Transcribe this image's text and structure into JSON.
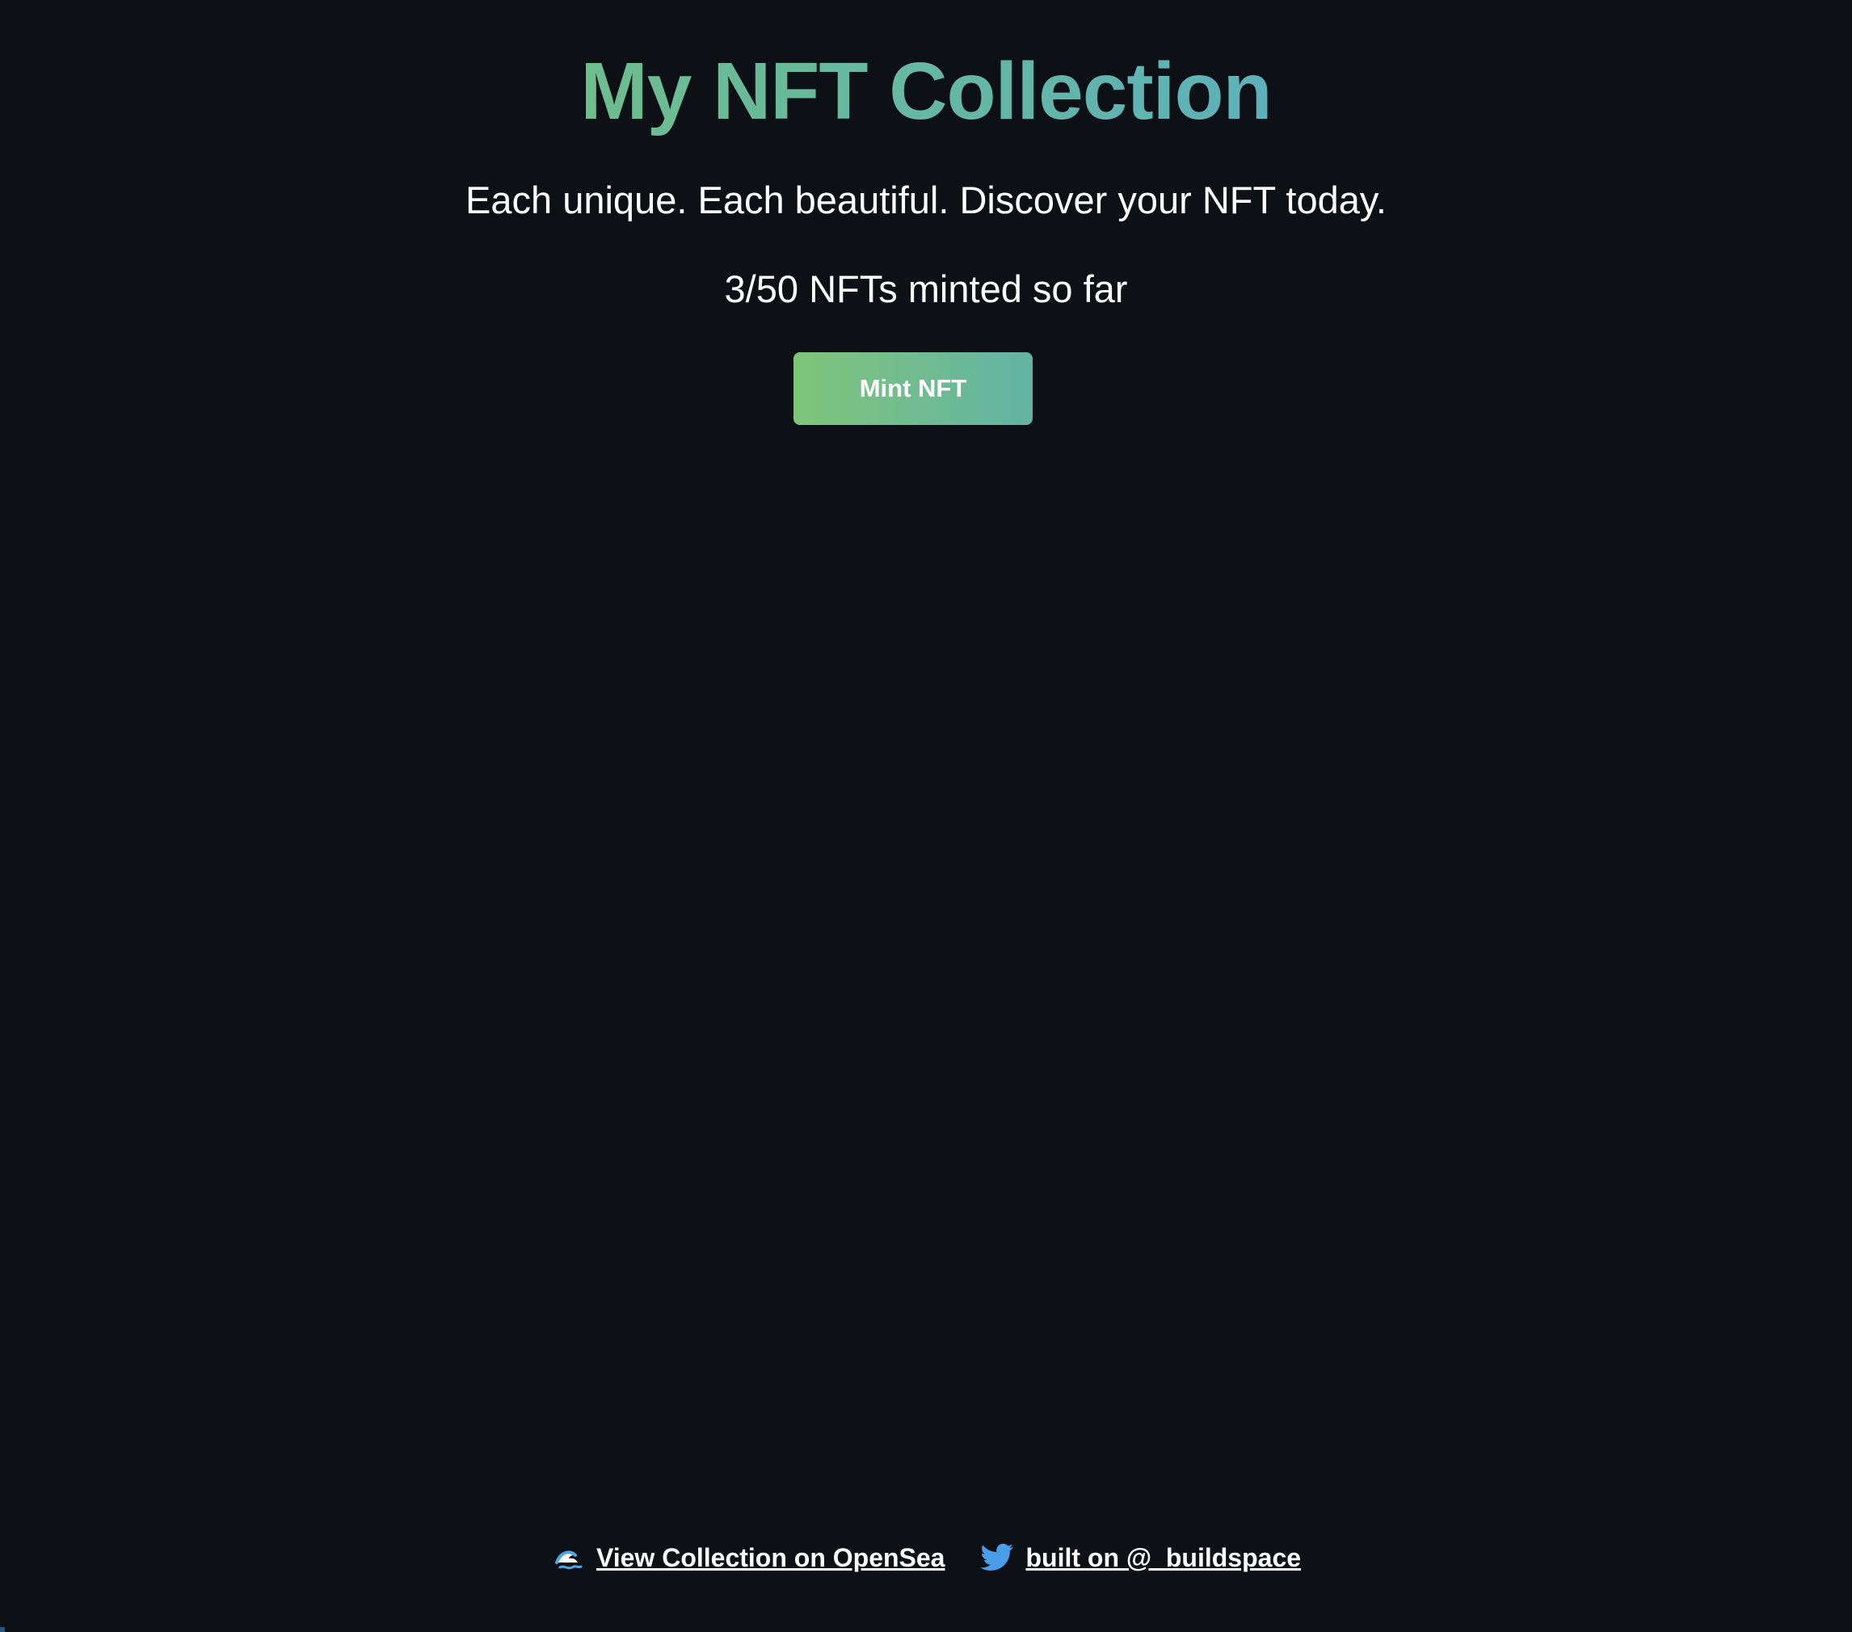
{
  "page": {
    "title": "My NFT Collection",
    "subtitle": "Each unique. Each beautiful. Discover your NFT today.",
    "mint_count_text": "3/50 NFTs minted so far",
    "mint_button_label": "Mint NFT"
  },
  "footer": {
    "opensea_label": "View Collection on OpenSea",
    "buildspace_label": "built on @_buildspace"
  },
  "icons": {
    "opensea": "wave-icon",
    "twitter": "twitter-icon"
  },
  "colors": {
    "background": "#0d1116",
    "title_gradient_start": "#7cc66c",
    "title_gradient_end": "#4ea6e6",
    "button_gradient_start": "#7fc57a",
    "button_gradient_end": "#63b3a5",
    "twitter_blue": "#4a9de8"
  }
}
